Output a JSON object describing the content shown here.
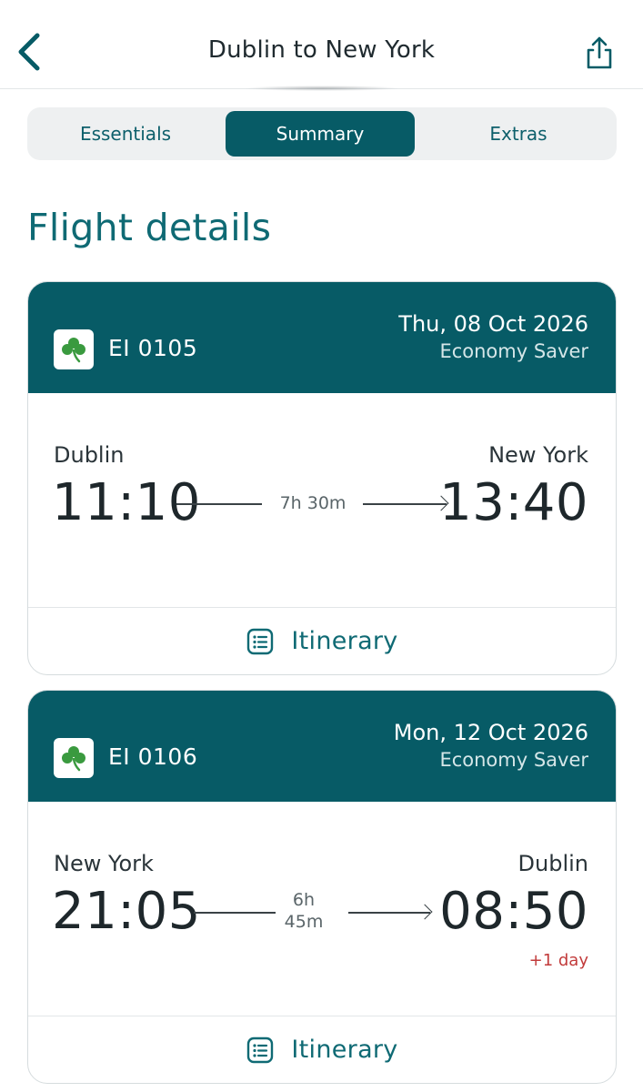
{
  "header": {
    "title": "Dublin to New York",
    "back_icon": "chevron-left-icon",
    "share_icon": "share-icon"
  },
  "tabs": [
    {
      "label": "Essentials",
      "active": false
    },
    {
      "label": "Summary",
      "active": true
    },
    {
      "label": "Extras",
      "active": false
    }
  ],
  "section_title": "Flight details",
  "colors": {
    "accent": "#075b66",
    "text_accent": "#0f6a74",
    "warning": "#c23b3b"
  },
  "flights": [
    {
      "flight_number": "EI 0105",
      "date": "Thu, 08 Oct 2026",
      "fare": "Economy Saver",
      "origin": "Dublin",
      "destination": "New York",
      "departure": "11:10",
      "arrival": "13:40",
      "duration": "7h 30m",
      "arrival_note": "",
      "itinerary_label": "Itinerary"
    },
    {
      "flight_number": "EI 0106",
      "date": "Mon, 12 Oct 2026",
      "fare": "Economy Saver",
      "origin": "New York",
      "destination": "Dublin",
      "departure": "21:05",
      "arrival": "08:50",
      "duration_line1": "6h",
      "duration_line2": "45m",
      "arrival_note": "+1 day",
      "itinerary_label": "Itinerary"
    }
  ]
}
